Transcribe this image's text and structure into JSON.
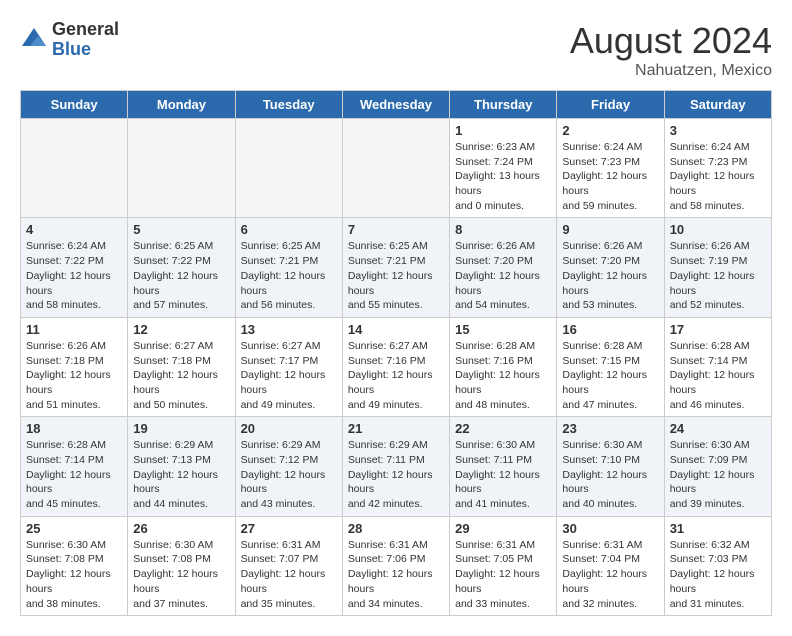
{
  "header": {
    "logo_general": "General",
    "logo_blue": "Blue",
    "month_year": "August 2024",
    "location": "Nahuatzen, Mexico"
  },
  "days_of_week": [
    "Sunday",
    "Monday",
    "Tuesday",
    "Wednesday",
    "Thursday",
    "Friday",
    "Saturday"
  ],
  "weeks": [
    [
      {
        "day": "",
        "empty": true
      },
      {
        "day": "",
        "empty": true
      },
      {
        "day": "",
        "empty": true
      },
      {
        "day": "",
        "empty": true
      },
      {
        "day": "1",
        "sunrise": "6:23 AM",
        "sunset": "7:24 PM",
        "daylight": "13 hours and 0 minutes."
      },
      {
        "day": "2",
        "sunrise": "6:24 AM",
        "sunset": "7:23 PM",
        "daylight": "12 hours and 59 minutes."
      },
      {
        "day": "3",
        "sunrise": "6:24 AM",
        "sunset": "7:23 PM",
        "daylight": "12 hours and 58 minutes."
      }
    ],
    [
      {
        "day": "4",
        "sunrise": "6:24 AM",
        "sunset": "7:22 PM",
        "daylight": "12 hours and 58 minutes."
      },
      {
        "day": "5",
        "sunrise": "6:25 AM",
        "sunset": "7:22 PM",
        "daylight": "12 hours and 57 minutes."
      },
      {
        "day": "6",
        "sunrise": "6:25 AM",
        "sunset": "7:21 PM",
        "daylight": "12 hours and 56 minutes."
      },
      {
        "day": "7",
        "sunrise": "6:25 AM",
        "sunset": "7:21 PM",
        "daylight": "12 hours and 55 minutes."
      },
      {
        "day": "8",
        "sunrise": "6:26 AM",
        "sunset": "7:20 PM",
        "daylight": "12 hours and 54 minutes."
      },
      {
        "day": "9",
        "sunrise": "6:26 AM",
        "sunset": "7:20 PM",
        "daylight": "12 hours and 53 minutes."
      },
      {
        "day": "10",
        "sunrise": "6:26 AM",
        "sunset": "7:19 PM",
        "daylight": "12 hours and 52 minutes."
      }
    ],
    [
      {
        "day": "11",
        "sunrise": "6:26 AM",
        "sunset": "7:18 PM",
        "daylight": "12 hours and 51 minutes."
      },
      {
        "day": "12",
        "sunrise": "6:27 AM",
        "sunset": "7:18 PM",
        "daylight": "12 hours and 50 minutes."
      },
      {
        "day": "13",
        "sunrise": "6:27 AM",
        "sunset": "7:17 PM",
        "daylight": "12 hours and 49 minutes."
      },
      {
        "day": "14",
        "sunrise": "6:27 AM",
        "sunset": "7:16 PM",
        "daylight": "12 hours and 49 minutes."
      },
      {
        "day": "15",
        "sunrise": "6:28 AM",
        "sunset": "7:16 PM",
        "daylight": "12 hours and 48 minutes."
      },
      {
        "day": "16",
        "sunrise": "6:28 AM",
        "sunset": "7:15 PM",
        "daylight": "12 hours and 47 minutes."
      },
      {
        "day": "17",
        "sunrise": "6:28 AM",
        "sunset": "7:14 PM",
        "daylight": "12 hours and 46 minutes."
      }
    ],
    [
      {
        "day": "18",
        "sunrise": "6:28 AM",
        "sunset": "7:14 PM",
        "daylight": "12 hours and 45 minutes."
      },
      {
        "day": "19",
        "sunrise": "6:29 AM",
        "sunset": "7:13 PM",
        "daylight": "12 hours and 44 minutes."
      },
      {
        "day": "20",
        "sunrise": "6:29 AM",
        "sunset": "7:12 PM",
        "daylight": "12 hours and 43 minutes."
      },
      {
        "day": "21",
        "sunrise": "6:29 AM",
        "sunset": "7:11 PM",
        "daylight": "12 hours and 42 minutes."
      },
      {
        "day": "22",
        "sunrise": "6:30 AM",
        "sunset": "7:11 PM",
        "daylight": "12 hours and 41 minutes."
      },
      {
        "day": "23",
        "sunrise": "6:30 AM",
        "sunset": "7:10 PM",
        "daylight": "12 hours and 40 minutes."
      },
      {
        "day": "24",
        "sunrise": "6:30 AM",
        "sunset": "7:09 PM",
        "daylight": "12 hours and 39 minutes."
      }
    ],
    [
      {
        "day": "25",
        "sunrise": "6:30 AM",
        "sunset": "7:08 PM",
        "daylight": "12 hours and 38 minutes."
      },
      {
        "day": "26",
        "sunrise": "6:30 AM",
        "sunset": "7:08 PM",
        "daylight": "12 hours and 37 minutes."
      },
      {
        "day": "27",
        "sunrise": "6:31 AM",
        "sunset": "7:07 PM",
        "daylight": "12 hours and 35 minutes."
      },
      {
        "day": "28",
        "sunrise": "6:31 AM",
        "sunset": "7:06 PM",
        "daylight": "12 hours and 34 minutes."
      },
      {
        "day": "29",
        "sunrise": "6:31 AM",
        "sunset": "7:05 PM",
        "daylight": "12 hours and 33 minutes."
      },
      {
        "day": "30",
        "sunrise": "6:31 AM",
        "sunset": "7:04 PM",
        "daylight": "12 hours and 32 minutes."
      },
      {
        "day": "31",
        "sunrise": "6:32 AM",
        "sunset": "7:03 PM",
        "daylight": "12 hours and 31 minutes."
      }
    ]
  ],
  "labels": {
    "sunrise": "Sunrise:",
    "sunset": "Sunset:",
    "daylight": "Daylight:"
  }
}
